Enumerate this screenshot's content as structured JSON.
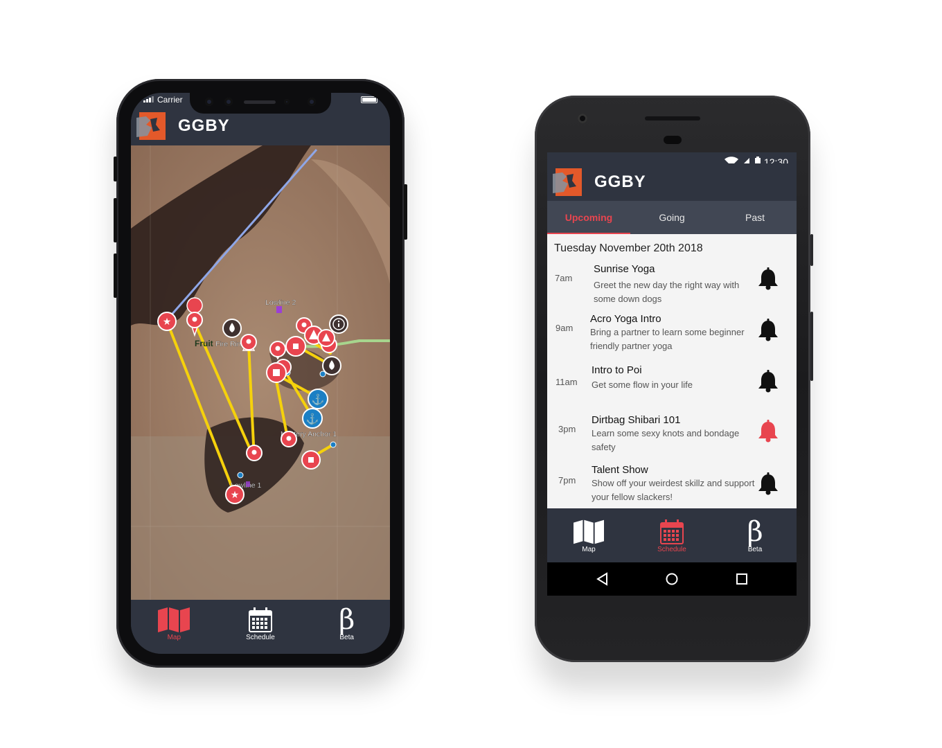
{
  "ios": {
    "carrier": "Carrier",
    "app_name": "GGBY",
    "map_labels": {
      "lowline2": "Lowline 2",
      "fire_ring": "Fire Ring 6",
      "fruit": "Fruit",
      "mystery_anchor": "Mystery Anchor 1",
      "lowline1": "Lowline 1"
    },
    "nav": [
      {
        "label": "Map",
        "icon": "map-icon",
        "active": true
      },
      {
        "label": "Schedule",
        "icon": "calendar-icon",
        "active": false
      },
      {
        "label": "Beta",
        "icon": "beta-icon",
        "active": false
      }
    ]
  },
  "android": {
    "status_time": "12:30",
    "app_name": "GGBY",
    "tabs": [
      {
        "label": "Upcoming",
        "active": true
      },
      {
        "label": "Going",
        "active": false
      },
      {
        "label": "Past",
        "active": false
      }
    ],
    "date_heading": "Tuesday November 20th 2018",
    "events": [
      {
        "time": "7am",
        "title": "Sunrise Yoga",
        "description": "Greet the new day the right way with some down dogs",
        "bell_active": false
      },
      {
        "time": "9am",
        "title": "Acro Yoga Intro",
        "description": "Bring a partner to learn some beginner friendly partner yoga",
        "bell_active": false
      },
      {
        "time": "11am",
        "title": "Intro to Poi",
        "description": "Get some flow in your life",
        "bell_active": false
      },
      {
        "time": "3pm",
        "title": "Dirtbag Shibari 101",
        "description": "Learn some sexy knots and bondage safety",
        "bell_active": true
      },
      {
        "time": "7pm",
        "title": "Talent Show",
        "description": "Show off your weirdest skillz and support your fellow slackers!",
        "bell_active": false
      }
    ],
    "nav": [
      {
        "label": "Map",
        "icon": "map-icon",
        "active": false
      },
      {
        "label": "Schedule",
        "icon": "calendar-icon",
        "active": true
      },
      {
        "label": "Beta",
        "icon": "beta-icon",
        "active": false
      }
    ],
    "beta_glyph": "β"
  },
  "colors": {
    "accent": "#e8454f",
    "header_bg": "#2f3440",
    "tab_bg": "#414754",
    "logo_orange": "#e3592a",
    "highline": "#f5d10c",
    "marker_red": "#e8454f",
    "marker_blue": "#1b7fc4",
    "marker_brown": "#3f3130"
  }
}
